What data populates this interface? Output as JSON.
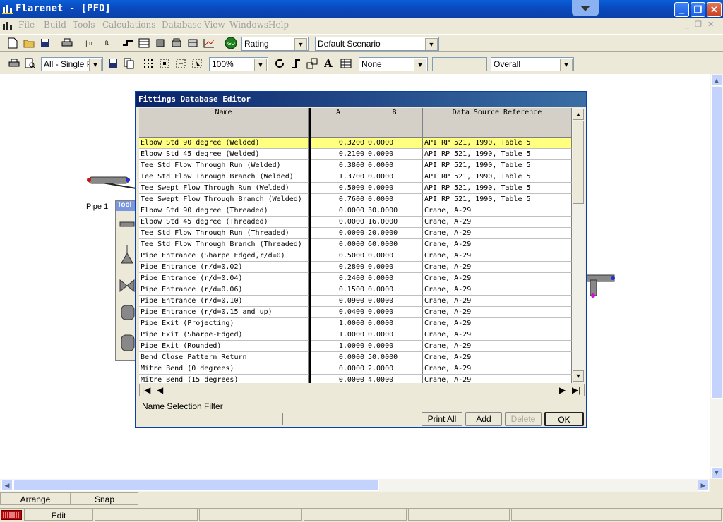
{
  "window": {
    "title": "Flarenet - [PFD]"
  },
  "menu": [
    "File",
    "Build",
    "Tools",
    "Calculations",
    "Database",
    "View",
    "Windows",
    "Help"
  ],
  "toolbar1": {
    "mode_combo": "Rating",
    "scenario_combo": "Default Scenario",
    "units_m": "m",
    "units_ft": "ft"
  },
  "toolbar2": {
    "view_combo": "All - Single Pa",
    "zoom_combo": "100%",
    "label_combo": "None",
    "blank_combo": "",
    "result_combo": "Overall",
    "text_tool": "A"
  },
  "pfd": {
    "pipe_label": "Pipe 1",
    "toolbox_title": "Tool"
  },
  "dialog": {
    "title": "Fittings Database Editor",
    "columns": [
      "Name",
      "A",
      "B",
      "Data Source Reference"
    ],
    "rows": [
      [
        "Elbow Std 90 degree (Welded)",
        "0.3200",
        "0.0000",
        "API RP 521, 1990, Table 5"
      ],
      [
        "Elbow Std 45 degree (Welded)",
        "0.2100",
        "0.0000",
        "API RP 521, 1990, Table 5"
      ],
      [
        "Tee Std Flow Through Run (Welded)",
        "0.3800",
        "0.0000",
        "API RP 521, 1990, Table 5"
      ],
      [
        "Tee Std Flow Through Branch (Welded)",
        "1.3700",
        "0.0000",
        "API RP 521, 1990, Table 5"
      ],
      [
        "Tee Swept Flow Through Run (Welded)",
        "0.5000",
        "0.0000",
        "API RP 521, 1990, Table 5"
      ],
      [
        "Tee Swept Flow Through Branch (Welded)",
        "0.7600",
        "0.0000",
        "API RP 521, 1990, Table 5"
      ],
      [
        "Elbow Std 90 degree (Threaded)",
        "0.0000",
        "30.0000",
        "Crane, A-29"
      ],
      [
        "Elbow Std 45 degree (Threaded)",
        "0.0000",
        "16.0000",
        "Crane, A-29"
      ],
      [
        "Tee Std Flow Through Run (Threaded)",
        "0.0000",
        "20.0000",
        "Crane, A-29"
      ],
      [
        "Tee Std Flow Through Branch (Threaded)",
        "0.0000",
        "60.0000",
        "Crane, A-29"
      ],
      [
        "Pipe Entrance (Sharpe Edged,r/d=0)",
        "0.5000",
        "0.0000",
        "Crane, A-29"
      ],
      [
        "Pipe Entrance (r/d=0.02)",
        "0.2800",
        "0.0000",
        "Crane, A-29"
      ],
      [
        "Pipe Entrance (r/d=0.04)",
        "0.2400",
        "0.0000",
        "Crane, A-29"
      ],
      [
        "Pipe Entrance (r/d=0.06)",
        "0.1500",
        "0.0000",
        "Crane, A-29"
      ],
      [
        "Pipe Entrance (r/d=0.10)",
        "0.0900",
        "0.0000",
        "Crane, A-29"
      ],
      [
        "Pipe Entrance (r/d=0.15 and up)",
        "0.0400",
        "0.0000",
        "Crane, A-29"
      ],
      [
        "Pipe Exit (Projecting)",
        "1.0000",
        "0.0000",
        "Crane, A-29"
      ],
      [
        "Pipe Exit (Sharpe-Edged)",
        "1.0000",
        "0.0000",
        "Crane, A-29"
      ],
      [
        "Pipe Exit (Rounded)",
        "1.0000",
        "0.0000",
        "Crane, A-29"
      ],
      [
        "Bend Close Pattern Return",
        "0.0000",
        "50.0000",
        "Crane, A-29"
      ],
      [
        "Mitre Bend (0 degrees)",
        "0.0000",
        "2.0000",
        "Crane, A-29"
      ],
      [
        "Mitre Bend (15 degrees)",
        "0.0000",
        "4.0000",
        "Crane, A-29"
      ]
    ],
    "selected_row": 0,
    "filter_label": "Name Selection Filter",
    "filter_value": "",
    "buttons": {
      "print_all": "Print All",
      "add": "Add",
      "delete": "Delete",
      "ok": "OK"
    }
  },
  "statusbar": {
    "arrange": "Arrange",
    "snap": "Snap",
    "mode": "Edit"
  }
}
